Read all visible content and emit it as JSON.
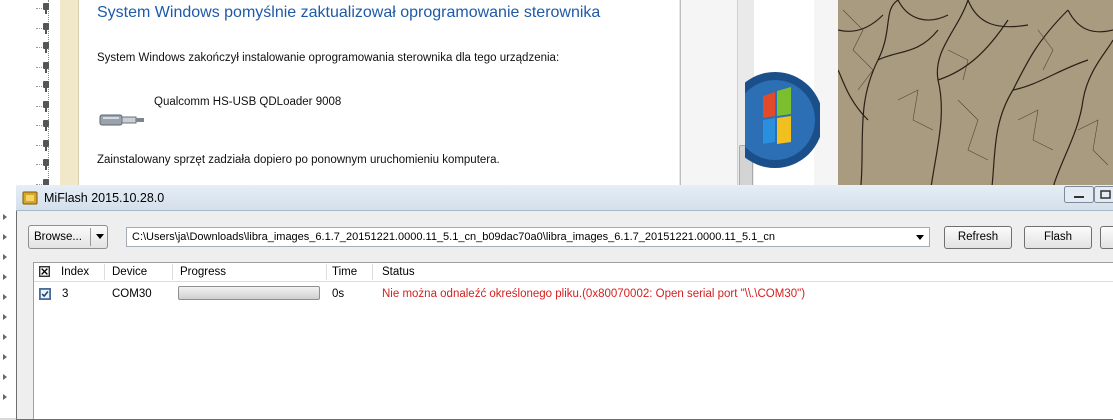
{
  "install_dialog": {
    "title": "System Windows pomyślnie zaktualizował oprogramowanie sterownika",
    "message": "System Windows zakończył instalowanie oprogramowania sterownika dla tego urządzenia:",
    "device_name": "Qualcomm HS-USB QDLoader 9008",
    "restart_message": "Zainstalowany sprzęt zadziała dopiero po ponownym uruchomieniu komputera.",
    "device_icon": "usb-plug-icon"
  },
  "miflash": {
    "title": "MiFlash 2015.10.28.0",
    "app_icon": "miflash-app-icon",
    "browse_label": "Browse...",
    "path_value": "C:\\Users\\ja\\Downloads\\libra_images_6.1.7_20151221.0000.11_5.1_cn_b09dac70a0\\libra_images_6.1.7_20151221.0000.11_5.1_cn",
    "refresh_label": "Refresh",
    "flash_label": "Flash",
    "columns": [
      "Index",
      "Device",
      "Progress",
      "Time",
      "Status"
    ],
    "rows": [
      {
        "checked": true,
        "index": "3",
        "device": "COM30",
        "progress": 0,
        "time": "0s",
        "status": "Nie można odnaleźć określonego pliku.(0x80070002: Open serial port \"\\\\.\\COM30\")"
      }
    ]
  },
  "colors": {
    "title_blue": "#1e5aa8",
    "status_error": "#d42020"
  }
}
